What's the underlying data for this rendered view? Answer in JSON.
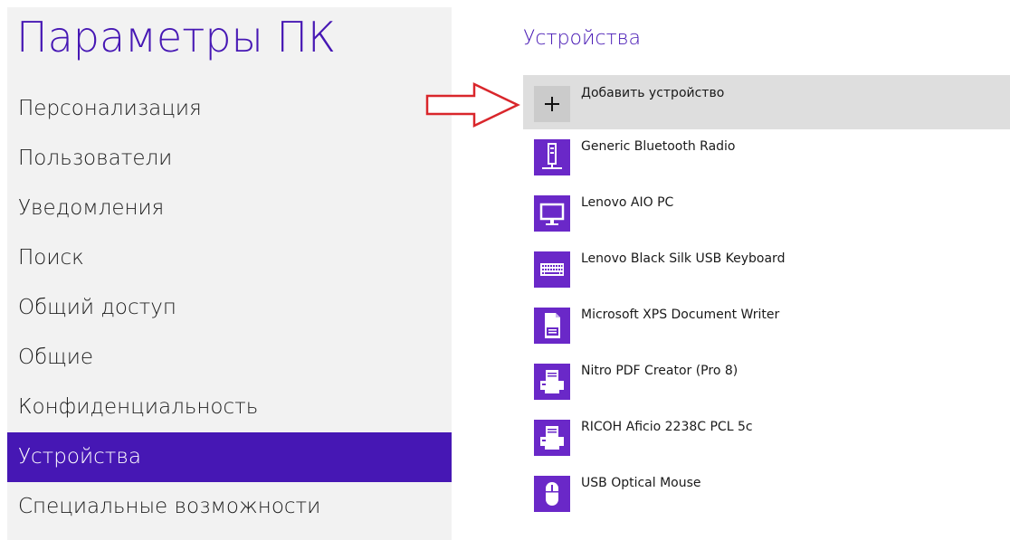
{
  "app_title": "Параметры ПК",
  "sidebar": {
    "items": [
      {
        "label": "Персонализация"
      },
      {
        "label": "Пользователи"
      },
      {
        "label": "Уведомления"
      },
      {
        "label": "Поиск"
      },
      {
        "label": "Общий доступ"
      },
      {
        "label": "Общие"
      },
      {
        "label": "Конфиденциальность"
      },
      {
        "label": "Устройства",
        "selected": true
      },
      {
        "label": "Специальные возможности"
      }
    ]
  },
  "main": {
    "section_title": "Устройства",
    "add_device_label": "Добавить устройство",
    "devices": [
      {
        "label": "Generic Bluetooth Radio",
        "icon": "bluetooth-radio-icon"
      },
      {
        "label": "Lenovo AIO PC",
        "icon": "monitor-icon"
      },
      {
        "label": "Lenovo Black Silk USB Keyboard",
        "icon": "keyboard-icon"
      },
      {
        "label": "Microsoft XPS Document Writer",
        "icon": "document-printer-icon"
      },
      {
        "label": "Nitro PDF Creator (Pro 8)",
        "icon": "printer-icon"
      },
      {
        "label": "RICOH Aficio 2238C PCL 5c",
        "icon": "printer-icon"
      },
      {
        "label": "USB Optical Mouse",
        "icon": "mouse-icon"
      }
    ]
  },
  "colors": {
    "accent": "#4617b4",
    "device_tile": "#6a28c8",
    "sidebar_bg": "#f2f2f2",
    "add_row_bg": "#dedede",
    "arrow": "#d9262b"
  }
}
